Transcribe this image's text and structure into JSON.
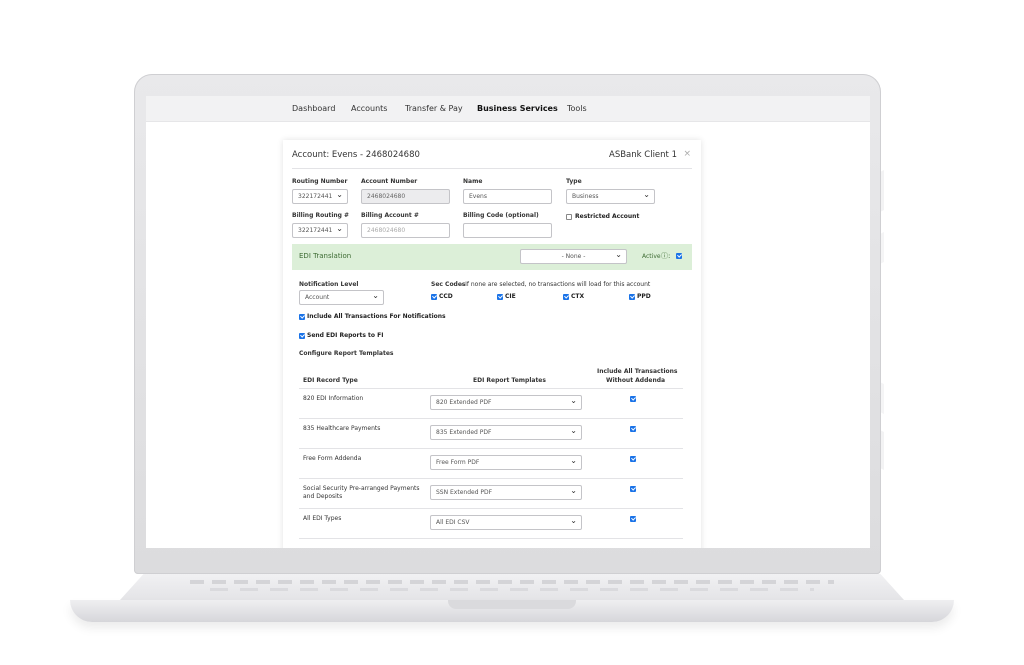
{
  "nav": {
    "items": [
      {
        "label": "Dashboard"
      },
      {
        "label": "Accounts"
      },
      {
        "label": "Transfer & Pay"
      },
      {
        "label": "Business Services",
        "active": true
      },
      {
        "label": "Tools"
      }
    ]
  },
  "card": {
    "title": "Account: Evens - 2468024680",
    "client": "ASBank Client 1",
    "close": "×"
  },
  "form": {
    "routing_label": "Routing Number",
    "routing_value": "322172441",
    "account_label": "Account Number",
    "account_value": "2468024680",
    "name_label": "Name",
    "name_value": "Evens",
    "type_label": "Type",
    "type_value": "Business",
    "billing_routing_label": "Billing Routing #",
    "billing_routing_value": "322172441",
    "billing_account_label": "Billing Account #",
    "billing_account_placeholder": "2468024680",
    "billing_code_label": "Billing Code (optional)",
    "billing_code_value": "",
    "restricted_label": "Restricted Account",
    "restricted_checked": false
  },
  "edi": {
    "title": "EDI Translation",
    "translation_select": "- None -",
    "active_label": "Active",
    "active_checked": true,
    "notification_label": "Notification Level",
    "notification_value": "Account",
    "sec_codes_label": "Sec Codes",
    "sec_codes_hint": " - If none are selected, no transactions will load for this account",
    "sec_codes": [
      {
        "label": "CCD",
        "checked": true
      },
      {
        "label": "CIE",
        "checked": true
      },
      {
        "label": "CTX",
        "checked": true
      },
      {
        "label": "PPD",
        "checked": true
      }
    ],
    "include_all_label": "Include All Transactions For Notifications",
    "send_reports_label": "Send EDI Reports to FI",
    "configure_label": "Configure Report Templates"
  },
  "table": {
    "col_type": "EDI Record Type",
    "col_templates": "EDI Report Templates",
    "col_include_1": "Include All Transactions",
    "col_include_2": "Without Addenda",
    "rows": [
      {
        "type": "820 EDI Information",
        "template": "820 Extended PDF",
        "include": true
      },
      {
        "type": "835 Healthcare Payments",
        "template": "835 Extended PDF",
        "include": true
      },
      {
        "type": "Free Form Addenda",
        "template": "Free Form PDF",
        "include": true
      },
      {
        "type": "Social Security Pre-arranged Payments and Deposits",
        "template": "SSN Extended PDF",
        "include": true
      },
      {
        "type": "All EDI Types",
        "template": "All EDI CSV",
        "include": true
      }
    ]
  },
  "colors": {
    "accent": "#1a73e8",
    "edi_bar": "#dcefd8",
    "edi_text": "#3d6b33"
  }
}
